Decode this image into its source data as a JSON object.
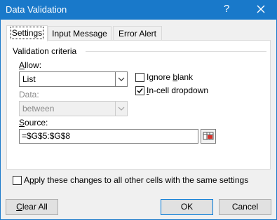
{
  "window": {
    "title": "Data Validation",
    "help": "?"
  },
  "tabs": [
    {
      "label": "Settings",
      "active": true
    },
    {
      "label": "Input Message",
      "active": false
    },
    {
      "label": "Error Alert",
      "active": false
    }
  ],
  "criteria": {
    "group_label": "Validation criteria",
    "allow_label_pre": "",
    "allow_label_acc": "A",
    "allow_label_post": "llow:",
    "allow_value": "List",
    "data_label": "Data:",
    "data_value": "between",
    "ignore_blank_pre": "Ignore ",
    "ignore_blank_acc": "b",
    "ignore_blank_post": "lank",
    "ignore_blank_checked": false,
    "dropdown_pre": "",
    "dropdown_acc": "I",
    "dropdown_post": "n-cell dropdown",
    "dropdown_checked": true,
    "source_label_pre": "",
    "source_label_acc": "S",
    "source_label_post": "ource:",
    "source_value": "=$G$5:$G$8"
  },
  "apply_all": {
    "pre": "A",
    "acc": "p",
    "post": "ply these changes to all other cells with the same settings",
    "checked": false
  },
  "buttons": {
    "clear_pre": "",
    "clear_acc": "C",
    "clear_post": "lear All",
    "ok": "OK",
    "cancel": "Cancel"
  },
  "colors": {
    "titlebar": "#1979ca",
    "face": "#f0f0f0",
    "default_button_border": "#0078d7"
  }
}
